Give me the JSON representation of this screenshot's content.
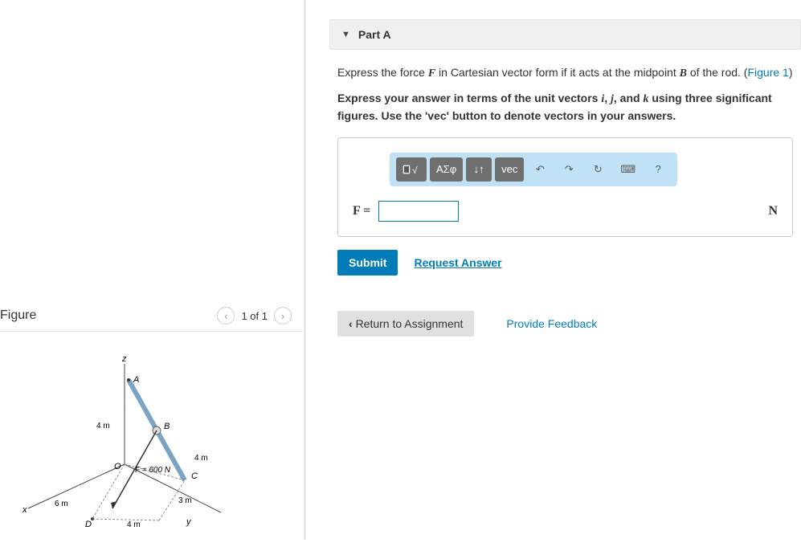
{
  "figure": {
    "title": "Figure",
    "nav_count": "1 of 1",
    "labels": {
      "z": "z",
      "x": "x",
      "y": "y",
      "A": "A",
      "B": "B",
      "C": "C",
      "D": "D",
      "O": "O",
      "dim_4m_vert": "4 m",
      "dim_4m_right": "4 m",
      "dim_3m": "3 m",
      "dim_4m_bottom": "4 m",
      "dim_6m": "6 m",
      "force": "F = 600 N"
    }
  },
  "part": {
    "title": "Part A",
    "question_pre": "Express the force ",
    "question_F": "F",
    "question_mid": " in Cartesian vector form if it acts at the midpoint ",
    "question_B": "B",
    "question_post": " of the rod. (",
    "figure_link": "Figure 1",
    "question_end": ")",
    "instruction_pre": "Express your answer in terms of the unit vectors ",
    "vec_i": "i",
    "vec_sep1": ", ",
    "vec_j": "j",
    "vec_sep2": ", and ",
    "vec_k": "k",
    "instruction_post": " using three significant figures. Use the 'vec' button to denote vectors in your answers.",
    "toolbar": {
      "templates": "√",
      "greek": "ΑΣφ",
      "arrows": "↓↑",
      "vec": "vec",
      "undo": "↶",
      "redo": "↷",
      "reset": "↻",
      "keyboard": "⌨",
      "help": "?"
    },
    "answer_label": "F =",
    "unit": "N",
    "submit": "Submit",
    "request": "Request Answer"
  },
  "footer": {
    "return": "Return to Assignment",
    "feedback": "Provide Feedback"
  }
}
